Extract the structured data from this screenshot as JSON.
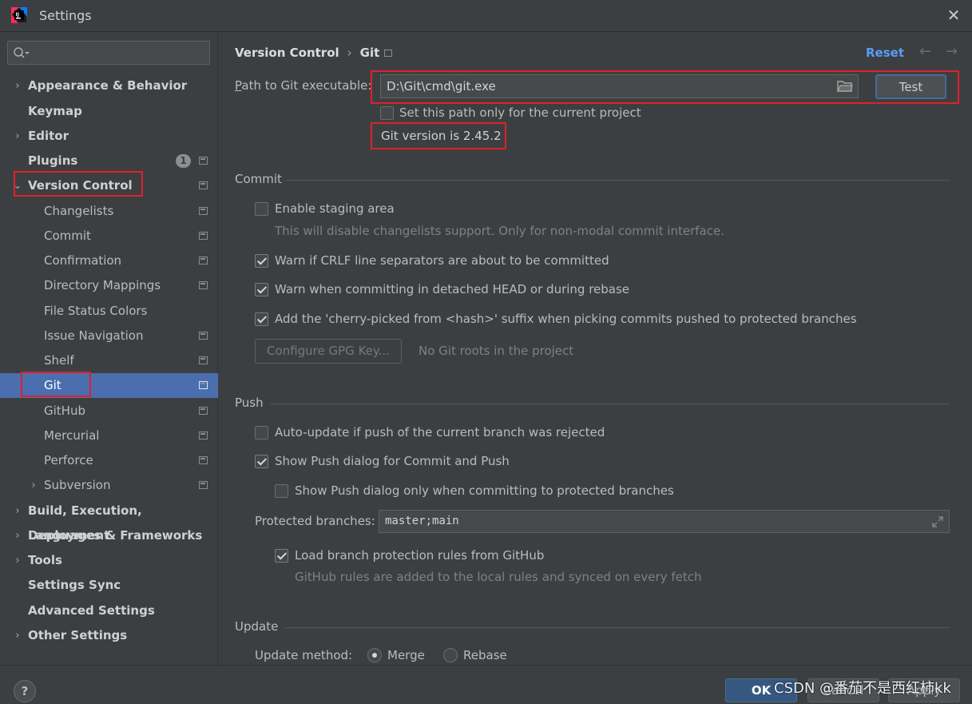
{
  "window": {
    "title": "Settings"
  },
  "sidebar": {
    "search_placeholder": "",
    "items": [
      {
        "label": "Appearance & Behavior",
        "level": 0,
        "arrow": "›"
      },
      {
        "label": "Keymap",
        "level": 0
      },
      {
        "label": "Editor",
        "level": 0,
        "arrow": "›"
      },
      {
        "label": "Plugins",
        "level": 0,
        "badge": "1"
      },
      {
        "label": "Version Control",
        "level": 0,
        "arrow": "⌄"
      },
      {
        "label": "Changelists",
        "level": 1
      },
      {
        "label": "Commit",
        "level": 1
      },
      {
        "label": "Confirmation",
        "level": 1
      },
      {
        "label": "Directory Mappings",
        "level": 1
      },
      {
        "label": "File Status Colors",
        "level": 1
      },
      {
        "label": "Issue Navigation",
        "level": 1
      },
      {
        "label": "Shelf",
        "level": 1
      },
      {
        "label": "Git",
        "level": 1
      },
      {
        "label": "GitHub",
        "level": 1
      },
      {
        "label": "Mercurial",
        "level": 1
      },
      {
        "label": "Perforce",
        "level": 1
      },
      {
        "label": "Subversion",
        "level": 1,
        "arrow": "›"
      },
      {
        "label": "Build, Execution, Deployment",
        "level": 0,
        "arrow": "›"
      },
      {
        "label": "Languages & Frameworks",
        "level": 0,
        "arrow": "›"
      },
      {
        "label": "Tools",
        "level": 0,
        "arrow": "›"
      },
      {
        "label": "Settings Sync",
        "level": 0
      },
      {
        "label": "Advanced Settings",
        "level": 0
      },
      {
        "label": "Other Settings",
        "level": 0,
        "arrow": "›"
      }
    ]
  },
  "header": {
    "breadcrumb_parent": "Version Control",
    "breadcrumb_sep": "›",
    "breadcrumb_current": "Git",
    "reset": "Reset",
    "back": "←",
    "forward": "→"
  },
  "git": {
    "path_label_first": "P",
    "path_label_rest": "ath to Git executable:",
    "path_value": "D:\\Git\\cmd\\git.exe",
    "test_button": "Test",
    "current_project_only": "Set this path only for the current project",
    "version_text": "Git version is 2.45.2"
  },
  "commit": {
    "section": "Commit",
    "staging_label": "Enable staging area",
    "staging_hint": "This will disable changelists support. Only for non-modal commit interface.",
    "crlf_label": "Warn if CRLF line separators are about to be committed",
    "detached_label": "Warn when committing in detached HEAD or during rebase",
    "cherry_label": "Add the 'cherry-picked from <hash>' suffix when picking commits pushed to protected branches",
    "gpg_button": "Configure GPG Key...",
    "gpg_hint": "No Git roots in the project"
  },
  "push": {
    "section": "Push",
    "auto_update_label": "Auto-update if push of the current branch was rejected",
    "show_dialog_label": "Show Push dialog for Commit and Push",
    "protected_only_label": "Show Push dialog only when committing to protected branches",
    "protected_branches_label": "Protected branches:",
    "protected_branches_value": "master;main",
    "load_rules_label": "Load branch protection rules from GitHub",
    "load_rules_hint": "GitHub rules are added to the local rules and synced on every fetch"
  },
  "update": {
    "section": "Update",
    "method_label": "Update method:",
    "merge_label": "Merge",
    "rebase_label": "Rebase"
  },
  "footer": {
    "help": "?",
    "ok": "OK",
    "cancel": "Cancel",
    "apply": "Apply",
    "watermark": "CSDN @番茄不是西红柿kk"
  }
}
